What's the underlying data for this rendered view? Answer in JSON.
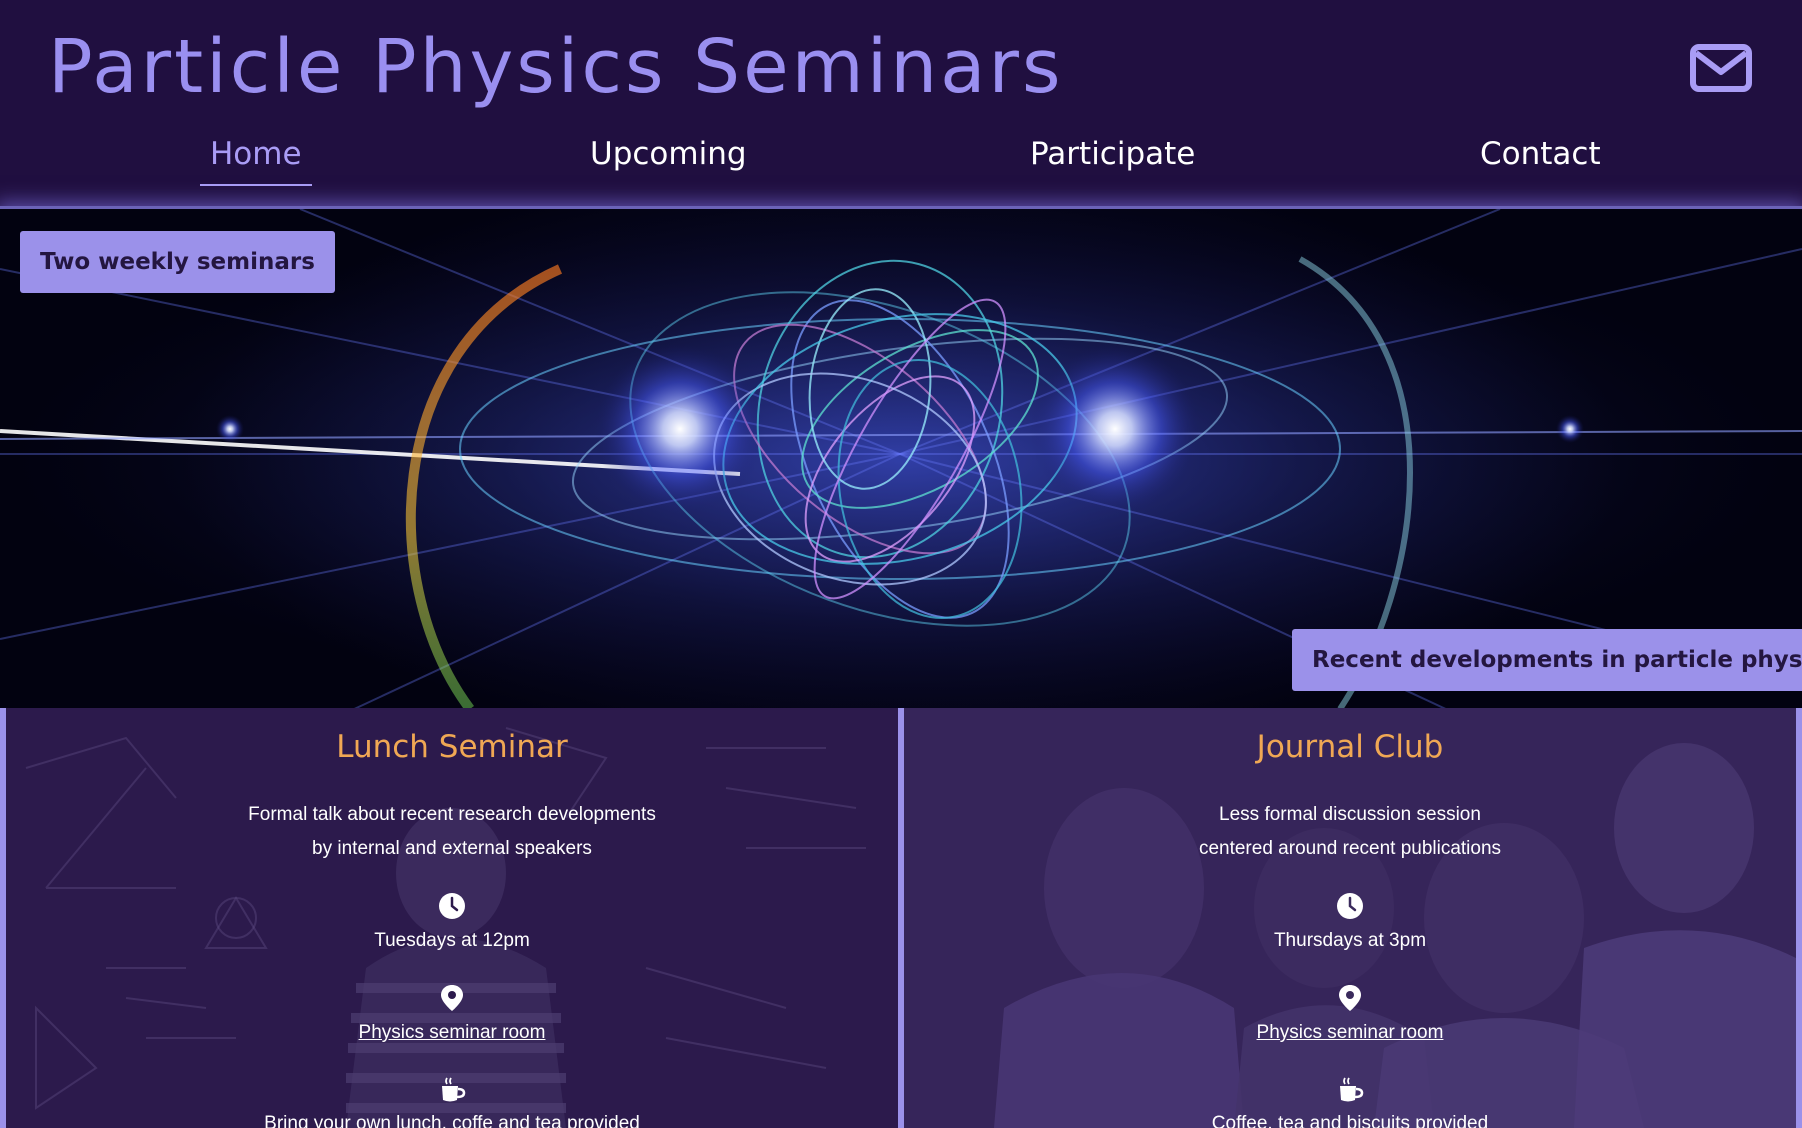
{
  "header": {
    "title": "Particle Physics Seminars",
    "mail_icon": "envelope-icon"
  },
  "nav": {
    "items": [
      {
        "label": "Home",
        "active": true
      },
      {
        "label": "Upcoming",
        "active": false
      },
      {
        "label": "Participate",
        "active": false
      },
      {
        "label": "Contact",
        "active": false
      }
    ]
  },
  "hero": {
    "badge_top": "Two weekly seminars",
    "badge_bottom": "Recent developments in particle physics"
  },
  "cards": [
    {
      "title": "Lunch Seminar",
      "description": [
        "Formal talk about recent research developments",
        "by internal and external speakers"
      ],
      "time": "Tuesdays at 12pm",
      "location": "Physics seminar room",
      "refreshments": "Bring your own lunch, coffe and tea provided"
    },
    {
      "title": "Journal Club",
      "description": [
        "Less formal discussion session",
        "centered around recent publications"
      ],
      "time": "Thursdays at 3pm",
      "location": "Physics seminar room",
      "refreshments": "Coffee, tea and biscuits provided"
    }
  ],
  "icons": {
    "clock": "clock-icon",
    "location": "map-pin-icon",
    "coffee": "coffee-cup-icon"
  },
  "colors": {
    "header_bg": "#200f40",
    "title_color": "#9a8ff0",
    "accent": "#9b91ea",
    "card_title": "#f0a854"
  }
}
